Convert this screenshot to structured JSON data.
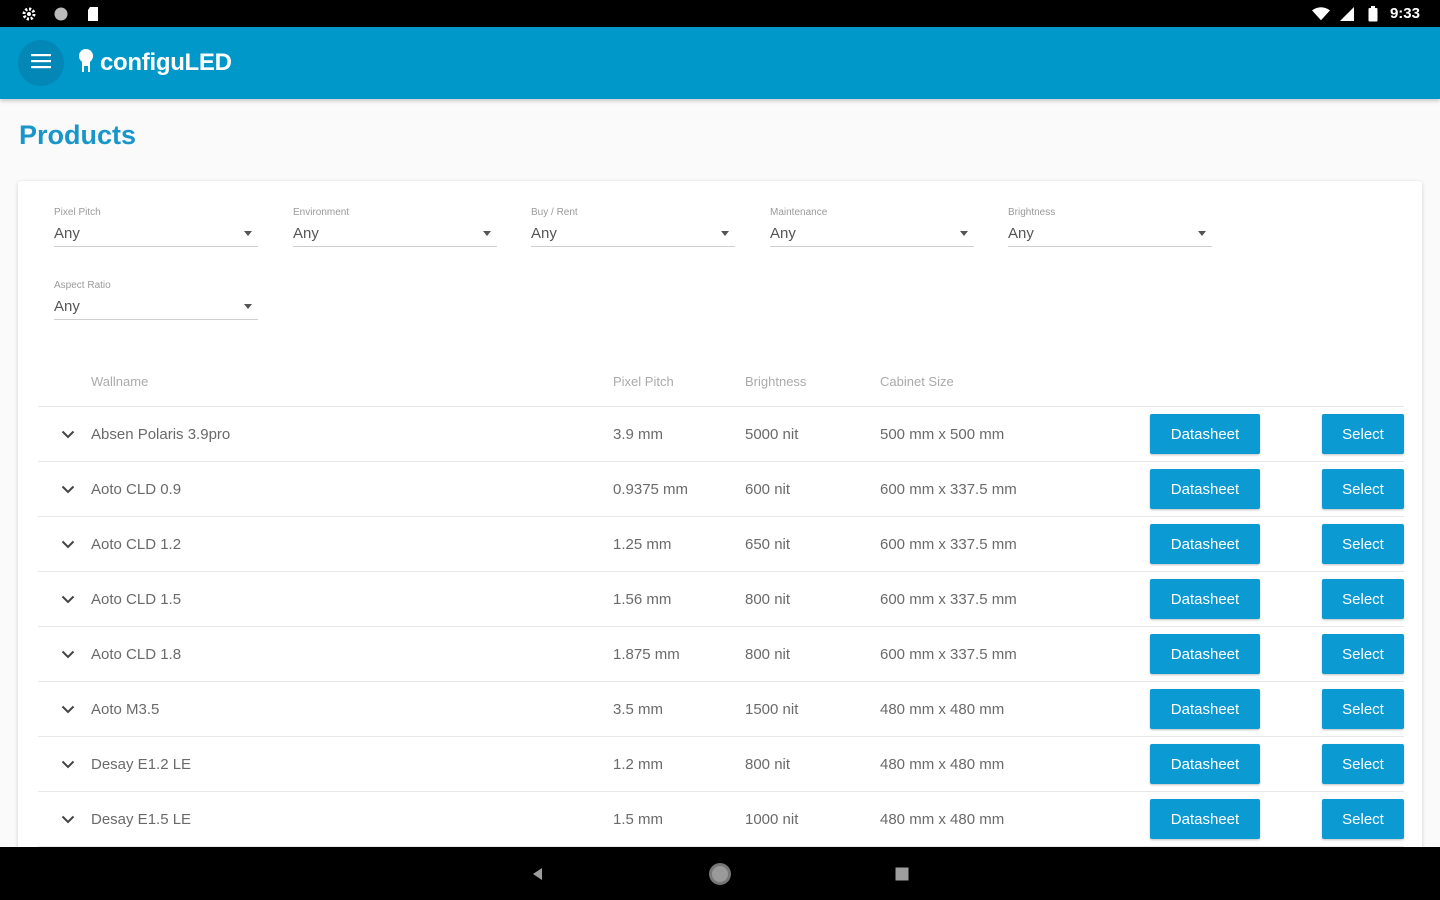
{
  "status_bar": {
    "time": "9:33"
  },
  "app_bar": {
    "logo_text": "configuLED"
  },
  "page": {
    "title": "Products"
  },
  "filters": [
    {
      "label": "Pixel Pitch",
      "value": "Any"
    },
    {
      "label": "Environment",
      "value": "Any"
    },
    {
      "label": "Buy / Rent",
      "value": "Any"
    },
    {
      "label": "Maintenance",
      "value": "Any"
    },
    {
      "label": "Brightness",
      "value": "Any"
    },
    {
      "label": "Aspect Ratio",
      "value": "Any"
    }
  ],
  "table": {
    "headers": {
      "name": "Wallname",
      "pitch": "Pixel Pitch",
      "brightness": "Brightness",
      "size": "Cabinet Size"
    },
    "datasheet_label": "Datasheet",
    "select_label": "Select",
    "rows": [
      {
        "name": "Absen Polaris 3.9pro",
        "pitch": "3.9 mm",
        "brightness": "5000 nit",
        "size": "500 mm x 500 mm"
      },
      {
        "name": "Aoto CLD 0.9",
        "pitch": "0.9375 mm",
        "brightness": "600 nit",
        "size": "600 mm x 337.5 mm"
      },
      {
        "name": "Aoto CLD 1.2",
        "pitch": "1.25 mm",
        "brightness": "650 nit",
        "size": "600 mm x 337.5 mm"
      },
      {
        "name": "Aoto CLD 1.5",
        "pitch": "1.56 mm",
        "brightness": "800 nit",
        "size": "600 mm x 337.5 mm"
      },
      {
        "name": "Aoto CLD 1.8",
        "pitch": "1.875 mm",
        "brightness": "800 nit",
        "size": "600 mm x 337.5 mm"
      },
      {
        "name": "Aoto M3.5",
        "pitch": "3.5 mm",
        "brightness": "1500 nit",
        "size": "480 mm x 480 mm"
      },
      {
        "name": "Desay E1.2 LE",
        "pitch": "1.2 mm",
        "brightness": "800 nit",
        "size": "480 mm x 480 mm"
      },
      {
        "name": "Desay E1.5 LE",
        "pitch": "1.5 mm",
        "brightness": "1000 nit",
        "size": "480 mm x 480 mm"
      }
    ]
  }
}
